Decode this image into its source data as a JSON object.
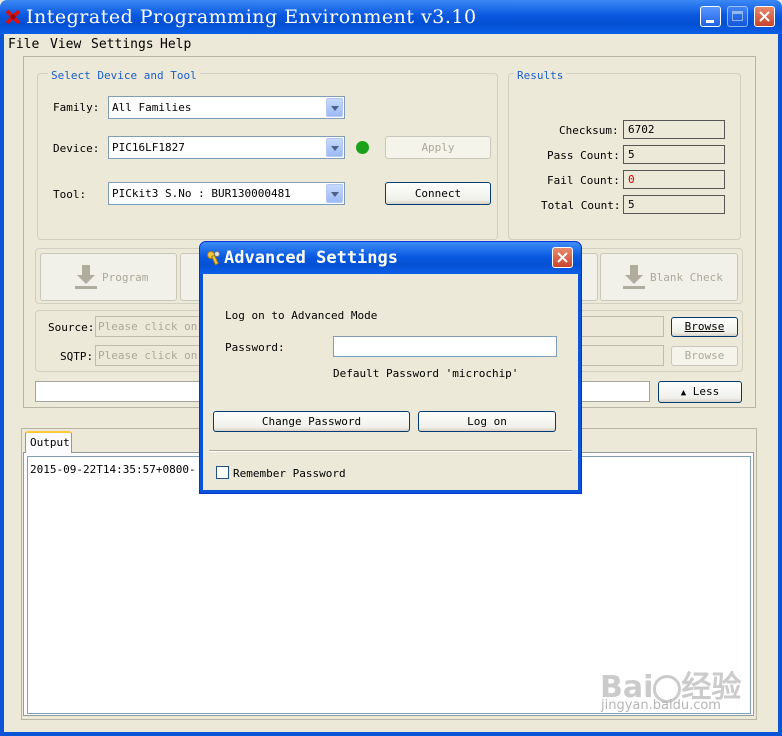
{
  "window": {
    "title": "Integrated Programming Environment v3.10"
  },
  "menu": [
    "File",
    "View",
    "Settings",
    "Help"
  ],
  "device_group": {
    "title": "Select Device and Tool",
    "family_label": "Family:",
    "family_value": "All Families",
    "device_label": "Device:",
    "device_value": "PIC16LF1827",
    "tool_label": "Tool:",
    "tool_value": "PICkit3 S.No : BUR130000481",
    "apply_label": "Apply",
    "connect_label": "Connect",
    "status_color": "#1aa11a"
  },
  "results": {
    "title": "Results",
    "checksum_label": "Checksum:",
    "checksum_value": "6702",
    "pass_label": "Pass Count:",
    "pass_value": "5",
    "fail_label": "Fail Count:",
    "fail_value": "0",
    "fail_color": "#d40000",
    "total_label": "Total Count:",
    "total_value": "5"
  },
  "actions": {
    "program_label": "Program",
    "blank_check_label": "Blank Check"
  },
  "files": {
    "source_label": "Source:",
    "source_placeholder": "Please click on b",
    "sqtp_label": "SQTP:",
    "sqtp_placeholder": "Please click on b",
    "browse_label": "Browse",
    "browse2_label": "Browse",
    "less_label": "Less"
  },
  "output": {
    "tab_label": "Output",
    "line1": "2015-09-22T14:35:57+0800- Co"
  },
  "dialog": {
    "title": "Advanced Settings",
    "heading": "Log on to Advanced Mode",
    "password_label": "Password:",
    "password_value": "",
    "hint": "Default Password 'microchip'",
    "change_password_label": "Change Password",
    "logon_label": "Log on",
    "remember_label": "Remember Password",
    "remember_checked": false
  },
  "watermark": {
    "text1": "Bai",
    "text2": "经验",
    "url": "jingyan.baidu.com"
  }
}
